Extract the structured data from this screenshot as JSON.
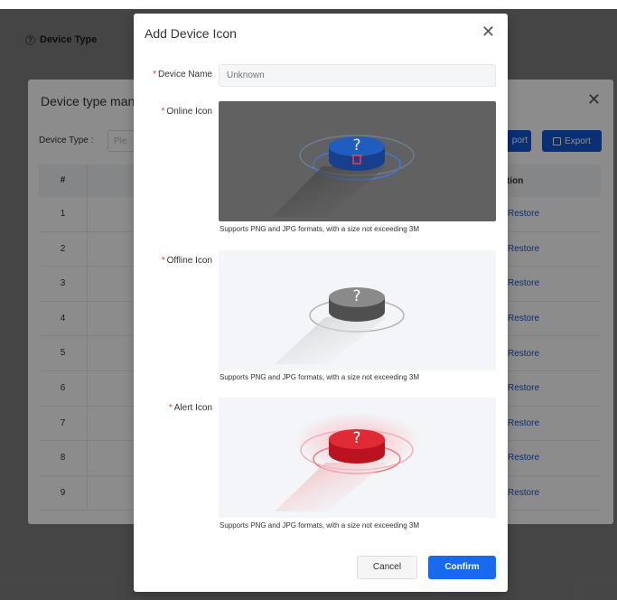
{
  "page": {
    "title": "Device Type"
  },
  "manager": {
    "title": "Device type man",
    "filter_label": "Device Type :",
    "filter_placeholder": "Ple",
    "import_label": "port",
    "export_label": "Export",
    "col_index": "#",
    "col_operation": "tion",
    "rows": [
      {
        "index": "1",
        "op": "Restore"
      },
      {
        "index": "2",
        "op": "Restore"
      },
      {
        "index": "3",
        "op": "Restore"
      },
      {
        "index": "4",
        "op": "Restore"
      },
      {
        "index": "5",
        "op": "Restore"
      },
      {
        "index": "6",
        "op": "Restore"
      },
      {
        "index": "7",
        "op": "Restore"
      },
      {
        "index": "8",
        "op": "Restore"
      },
      {
        "index": "9",
        "op": "Restore"
      }
    ]
  },
  "modal": {
    "title": "Add Device Icon",
    "required_mark": "*",
    "device_name_label": "Device Name",
    "device_name_placeholder": "Unknown",
    "online_label": "Online Icon",
    "offline_label": "Offline Icon",
    "alert_label": "Alert Icon",
    "hint": "Supports PNG and JPG formats, with a size not exceeding 3M",
    "icon_glyph": "?",
    "cancel_label": "Cancel",
    "confirm_label": "Confirm"
  },
  "colors": {
    "primary": "#1769ee",
    "online": "#1f5dbf",
    "offline": "#6e6e6e",
    "alert": "#e02a36",
    "required": "#e33333"
  }
}
